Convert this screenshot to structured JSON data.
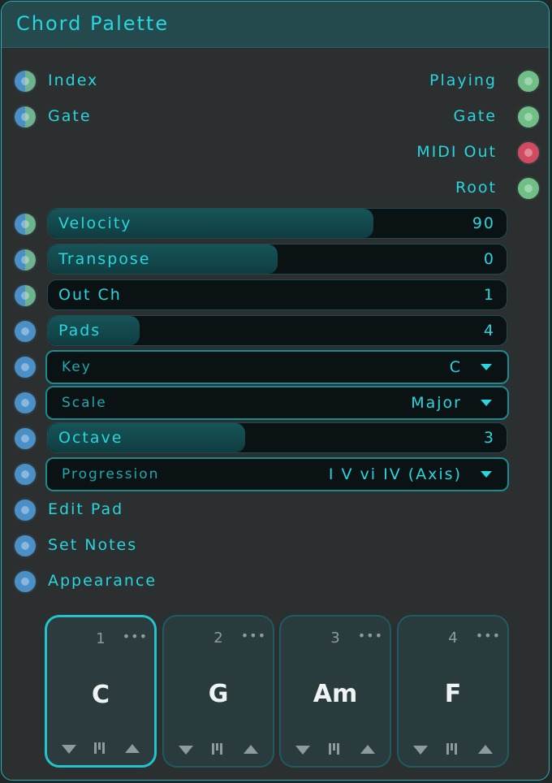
{
  "title": "Chord Palette",
  "inputs": [
    {
      "label": "Index",
      "type": "split"
    },
    {
      "label": "Gate",
      "type": "split"
    }
  ],
  "outputs": [
    {
      "label": "Playing",
      "color": "#6fbf86"
    },
    {
      "label": "Gate",
      "color": "#6fbf86"
    },
    {
      "label": "MIDI Out",
      "color": "#d04a60"
    },
    {
      "label": "Root",
      "color": "#6fbf86"
    }
  ],
  "sliders": [
    {
      "label": "Velocity",
      "value": "90",
      "fill": 0.71,
      "port": "split"
    },
    {
      "label": "Transpose",
      "value": "0",
      "fill": 0.5,
      "port": "split"
    },
    {
      "label": "Out Ch",
      "value": "1",
      "fill": 0.0,
      "port": "split"
    },
    {
      "label": "Pads",
      "value": "4",
      "fill": 0.2,
      "port": "blue"
    }
  ],
  "key_dropdown": {
    "label": "Key",
    "value": "C"
  },
  "scale_dropdown": {
    "label": "Scale",
    "value": "Major"
  },
  "octave_slider": {
    "label": "Octave",
    "value": "3",
    "fill": 0.43
  },
  "progression_dropdown": {
    "label": "Progression",
    "value": "I V vi IV (Axis)"
  },
  "buttons": [
    {
      "label": "Edit Pad"
    },
    {
      "label": "Set Notes"
    },
    {
      "label": "Appearance"
    }
  ],
  "pads": [
    {
      "number": "1",
      "chord": "C",
      "selected": true
    },
    {
      "number": "2",
      "chord": "G",
      "selected": false
    },
    {
      "number": "3",
      "chord": "Am",
      "selected": false
    },
    {
      "number": "4",
      "chord": "F",
      "selected": false
    }
  ],
  "pad_more_glyph": "•••",
  "colors": {
    "accent": "#27d6de",
    "panel": "#2b2f30",
    "titlebar": "#244a4d"
  }
}
